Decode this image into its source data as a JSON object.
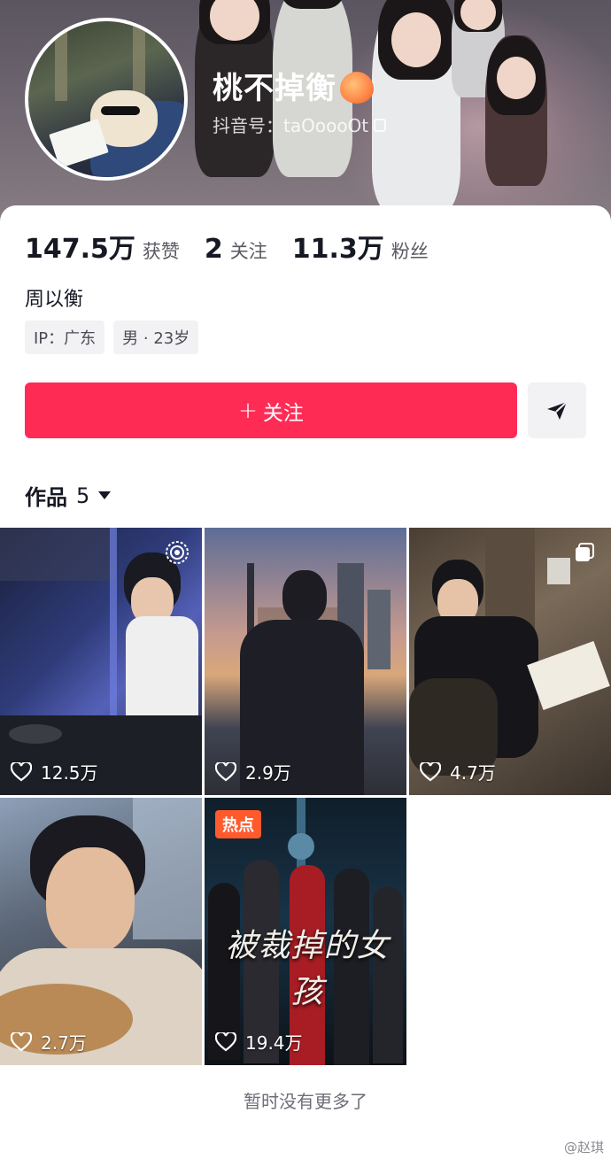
{
  "profile": {
    "nickname": "桃不掉衡",
    "douyin_id_label": "抖音号：",
    "douyin_id": "taOoooOt",
    "real_name": "周以衡",
    "tags": [
      "IP：广东",
      "男 · 23岁"
    ]
  },
  "stats": [
    {
      "value": "147.5万",
      "label": "获赞"
    },
    {
      "value": "2",
      "label": "关注"
    },
    {
      "value": "11.3万",
      "label": "粉丝"
    }
  ],
  "actions": {
    "follow_label": "关注",
    "follow_plus": "+"
  },
  "works": {
    "label": "作品",
    "count": "5",
    "end_text": "暂时没有更多了"
  },
  "videos": [
    {
      "likes": "12.5万",
      "badge": "",
      "icon": "live-icon"
    },
    {
      "likes": "2.9万",
      "badge": "",
      "icon": ""
    },
    {
      "likes": "4.7万",
      "badge": "",
      "icon": "multi-image-icon"
    },
    {
      "likes": "2.7万",
      "badge": "",
      "icon": ""
    },
    {
      "likes": "19.4万",
      "badge": "热点",
      "icon": "",
      "poster_title": "被裁掉的女孩"
    }
  ],
  "watermark": "@赵琪",
  "colors": {
    "accent": "#fe2c55",
    "hot_badge": "#ff5a2c",
    "text_primary": "#161823"
  }
}
